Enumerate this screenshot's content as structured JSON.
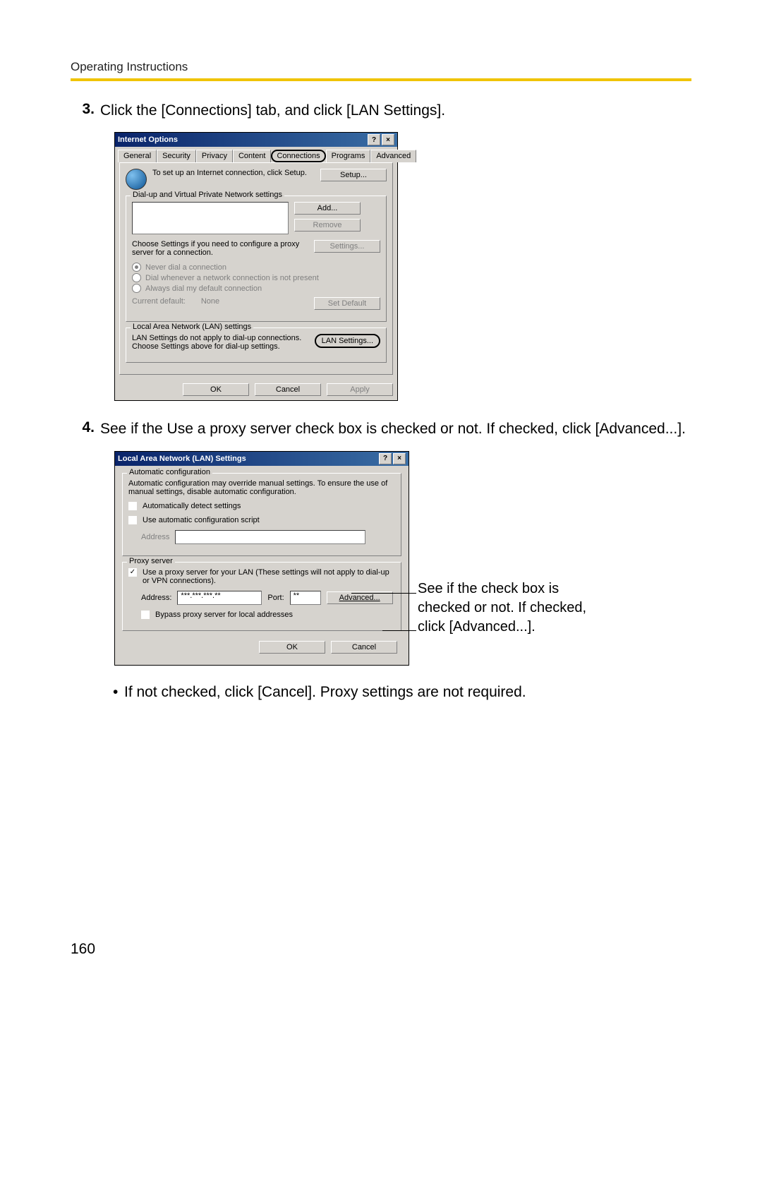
{
  "header": "Operating Instructions",
  "step3": {
    "num": "3.",
    "text": "Click the [Connections] tab, and click [LAN Settings]."
  },
  "step4": {
    "num": "4.",
    "text": "See if the Use a proxy server check box is checked or not. If checked, click [Advanced...]."
  },
  "bullet": "If not checked, click [Cancel]. Proxy settings are not required.",
  "page_number": "160",
  "io": {
    "title": "Internet Options",
    "help_btn": "?",
    "close_btn": "×",
    "tabs": {
      "general": "General",
      "security": "Security",
      "privacy": "Privacy",
      "content": "Content",
      "connections": "Connections",
      "programs": "Programs",
      "advanced": "Advanced"
    },
    "setup_text": "To set up an Internet connection, click Setup.",
    "setup_btn": "Setup...",
    "dialup_group": "Dial-up and Virtual Private Network settings",
    "add_btn": "Add...",
    "remove_btn": "Remove",
    "choose_text": "Choose Settings if you need to configure a proxy server for a connection.",
    "settings_btn": "Settings...",
    "radio_never": "Never dial a connection",
    "radio_whenever": "Dial whenever a network connection is not present",
    "radio_always": "Always dial my default connection",
    "current_default_label": "Current default:",
    "current_default_value": "None",
    "set_default_btn": "Set Default",
    "lan_group": "Local Area Network (LAN) settings",
    "lan_text": "LAN Settings do not apply to dial-up connections. Choose Settings above for dial-up settings.",
    "lan_btn": "LAN Settings...",
    "ok": "OK",
    "cancel": "Cancel",
    "apply": "Apply"
  },
  "lan": {
    "title": "Local Area Network (LAN) Settings",
    "help_btn": "?",
    "close_btn": "×",
    "auto_group": "Automatic configuration",
    "auto_text": "Automatic configuration may override manual settings. To ensure the use of manual settings, disable automatic configuration.",
    "auto_detect": "Automatically detect settings",
    "use_script": "Use automatic configuration script",
    "address_label": "Address",
    "proxy_group": "Proxy server",
    "proxy_text": "Use a proxy server for your LAN (These settings will not apply to dial-up or VPN connections).",
    "addr_label": "Address:",
    "addr_value": "***.***.***.**",
    "port_label": "Port:",
    "port_value": "**",
    "advanced_btn": "Advanced...",
    "bypass": "Bypass proxy server for local addresses",
    "ok": "OK",
    "cancel": "Cancel"
  },
  "annotation": "See if the check box is checked or not. If checked, click [Advanced...]."
}
